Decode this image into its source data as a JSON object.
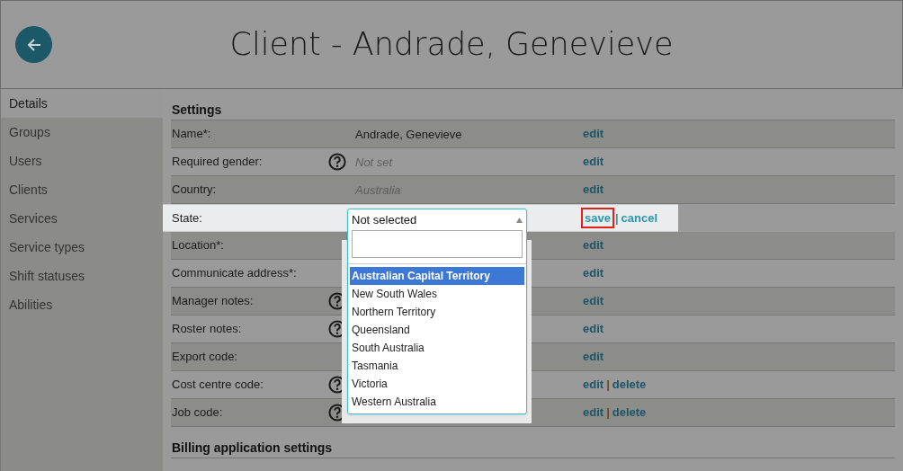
{
  "header": {
    "title": "Client - Andrade, Genevieve"
  },
  "sidebar": {
    "items": [
      {
        "label": "Details",
        "selected": true
      },
      {
        "label": "Groups",
        "selected": false
      },
      {
        "label": "Users",
        "selected": false
      },
      {
        "label": "Clients",
        "selected": false
      },
      {
        "label": "Services",
        "selected": false
      },
      {
        "label": "Service types",
        "selected": false
      },
      {
        "label": "Shift statuses",
        "selected": false
      },
      {
        "label": "Abilities",
        "selected": false
      }
    ]
  },
  "sections": [
    {
      "title": "Settings",
      "rows": [
        {
          "label": "Name*:",
          "help": false,
          "value": "Andrade, Genevieve",
          "muted": false,
          "actions": [
            {
              "label": "edit",
              "outlined": false
            }
          ]
        },
        {
          "label": "Required gender:",
          "help": true,
          "value": "Not set",
          "muted": true,
          "actions": [
            {
              "label": "edit",
              "outlined": false
            }
          ]
        },
        {
          "label": "Country:",
          "help": false,
          "value": "Australia",
          "muted": true,
          "actions": [
            {
              "label": "edit",
              "outlined": false
            }
          ]
        },
        {
          "label": "State:",
          "help": false,
          "editing": true,
          "select": {
            "value": "Not selected",
            "options": [
              {
                "label": "Australian Capital Territory",
                "selected": true
              },
              {
                "label": "New South Wales",
                "selected": false
              },
              {
                "label": "Northern Territory",
                "selected": false
              },
              {
                "label": "Queensland",
                "selected": false
              },
              {
                "label": "South Australia",
                "selected": false
              },
              {
                "label": "Tasmania",
                "selected": false
              },
              {
                "label": "Victoria",
                "selected": false
              },
              {
                "label": "Western Australia",
                "selected": false
              }
            ]
          },
          "actions": [
            {
              "label": "save",
              "outlined": true
            },
            {
              "kind": "separator",
              "label": "|"
            },
            {
              "label": "cancel",
              "outlined": false
            }
          ]
        },
        {
          "label": "Location*:",
          "help": false,
          "actions": [
            {
              "label": "edit",
              "outlined": false
            }
          ]
        },
        {
          "label": "Communicate address*:",
          "help": false,
          "actions": [
            {
              "label": "edit",
              "outlined": false
            }
          ]
        },
        {
          "label": "Manager notes:",
          "help": true,
          "actions": [
            {
              "label": "edit",
              "outlined": false
            }
          ]
        },
        {
          "label": "Roster notes:",
          "help": true,
          "actions": [
            {
              "label": "edit",
              "outlined": false
            }
          ]
        },
        {
          "label": "Export code:",
          "help": false,
          "actions": [
            {
              "label": "edit",
              "outlined": false
            }
          ]
        },
        {
          "label": "Cost centre code:",
          "help": true,
          "actions": [
            {
              "label": "edit",
              "outlined": false
            },
            {
              "kind": "separator",
              "label": "|"
            },
            {
              "label": "delete",
              "outlined": false
            }
          ]
        },
        {
          "label": "Job code:",
          "help": true,
          "actions": [
            {
              "label": "edit",
              "outlined": false
            },
            {
              "kind": "separator",
              "label": "|"
            },
            {
              "label": "delete",
              "outlined": false
            }
          ]
        }
      ]
    },
    {
      "title": "Billing application settings"
    }
  ]
}
